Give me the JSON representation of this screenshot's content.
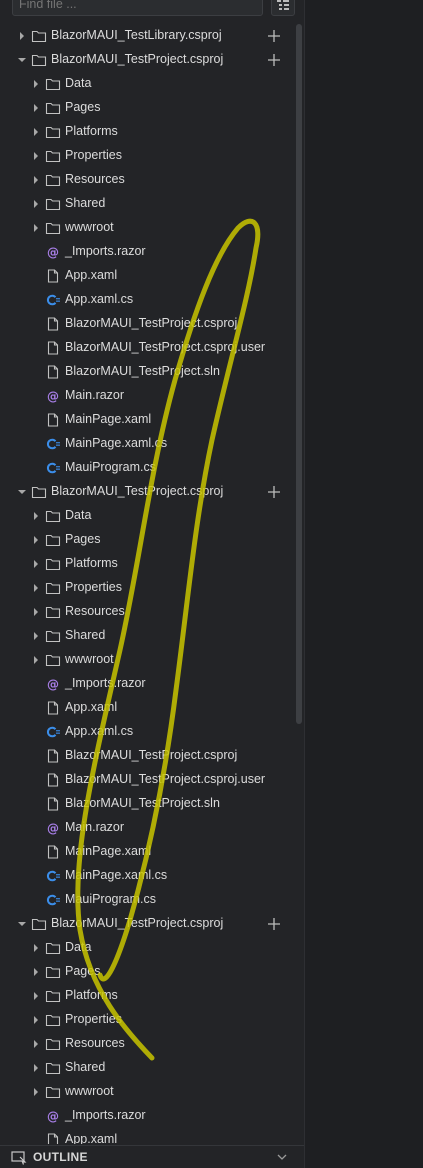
{
  "search": {
    "placeholder": "Find file ..."
  },
  "tree": [
    {
      "depth": 0,
      "kind": "project",
      "expanded": false,
      "label": "BlazorMAUI_TestLibrary.csproj",
      "plus": true
    },
    {
      "depth": 0,
      "kind": "project",
      "expanded": true,
      "label": "BlazorMAUI_TestProject.csproj",
      "plus": true
    },
    {
      "depth": 1,
      "kind": "folder",
      "label": "Data"
    },
    {
      "depth": 1,
      "kind": "folder",
      "label": "Pages"
    },
    {
      "depth": 1,
      "kind": "folder",
      "label": "Platforms"
    },
    {
      "depth": 1,
      "kind": "folder",
      "label": "Properties"
    },
    {
      "depth": 1,
      "kind": "folder",
      "label": "Resources"
    },
    {
      "depth": 1,
      "kind": "folder",
      "label": "Shared"
    },
    {
      "depth": 1,
      "kind": "folder",
      "label": "wwwroot"
    },
    {
      "depth": 1,
      "kind": "razor",
      "label": "_Imports.razor"
    },
    {
      "depth": 1,
      "kind": "file",
      "label": "App.xaml"
    },
    {
      "depth": 1,
      "kind": "cs",
      "label": "App.xaml.cs"
    },
    {
      "depth": 1,
      "kind": "file",
      "label": "BlazorMAUI_TestProject.csproj"
    },
    {
      "depth": 1,
      "kind": "file",
      "label": "BlazorMAUI_TestProject.csproj.user"
    },
    {
      "depth": 1,
      "kind": "file",
      "label": "BlazorMAUI_TestProject.sln"
    },
    {
      "depth": 1,
      "kind": "razor",
      "label": "Main.razor"
    },
    {
      "depth": 1,
      "kind": "file",
      "label": "MainPage.xaml"
    },
    {
      "depth": 1,
      "kind": "cs",
      "label": "MainPage.xaml.cs"
    },
    {
      "depth": 1,
      "kind": "cs",
      "label": "MauiProgram.cs"
    },
    {
      "depth": 0,
      "kind": "project",
      "expanded": true,
      "label": "BlazorMAUI_TestProject.csproj",
      "plus": true
    },
    {
      "depth": 1,
      "kind": "folder",
      "label": "Data"
    },
    {
      "depth": 1,
      "kind": "folder",
      "label": "Pages"
    },
    {
      "depth": 1,
      "kind": "folder",
      "label": "Platforms"
    },
    {
      "depth": 1,
      "kind": "folder",
      "label": "Properties"
    },
    {
      "depth": 1,
      "kind": "folder",
      "label": "Resources"
    },
    {
      "depth": 1,
      "kind": "folder",
      "label": "Shared"
    },
    {
      "depth": 1,
      "kind": "folder",
      "label": "wwwroot"
    },
    {
      "depth": 1,
      "kind": "razor",
      "label": "_Imports.razor"
    },
    {
      "depth": 1,
      "kind": "file",
      "label": "App.xaml"
    },
    {
      "depth": 1,
      "kind": "cs",
      "label": "App.xaml.cs"
    },
    {
      "depth": 1,
      "kind": "file",
      "label": "BlazorMAUI_TestProject.csproj"
    },
    {
      "depth": 1,
      "kind": "file",
      "label": "BlazorMAUI_TestProject.csproj.user"
    },
    {
      "depth": 1,
      "kind": "file",
      "label": "BlazorMAUI_TestProject.sln"
    },
    {
      "depth": 1,
      "kind": "razor",
      "label": "Main.razor"
    },
    {
      "depth": 1,
      "kind": "file",
      "label": "MainPage.xaml"
    },
    {
      "depth": 1,
      "kind": "cs",
      "label": "MainPage.xaml.cs"
    },
    {
      "depth": 1,
      "kind": "cs",
      "label": "MauiProgram.cs"
    },
    {
      "depth": 0,
      "kind": "project",
      "expanded": true,
      "label": "BlazorMAUI_TestProject.csproj",
      "plus": true
    },
    {
      "depth": 1,
      "kind": "folder",
      "label": "Data"
    },
    {
      "depth": 1,
      "kind": "folder",
      "label": "Pages"
    },
    {
      "depth": 1,
      "kind": "folder",
      "label": "Platforms"
    },
    {
      "depth": 1,
      "kind": "folder",
      "label": "Properties"
    },
    {
      "depth": 1,
      "kind": "folder",
      "label": "Resources"
    },
    {
      "depth": 1,
      "kind": "folder",
      "label": "Shared"
    },
    {
      "depth": 1,
      "kind": "folder",
      "label": "wwwroot"
    },
    {
      "depth": 1,
      "kind": "razor",
      "label": "_Imports.razor"
    },
    {
      "depth": 1,
      "kind": "file",
      "label": "App.xaml"
    }
  ],
  "outline": {
    "title": "OUTLINE"
  },
  "colors": {
    "cs_icon": "#3b8eea",
    "razor_icon": "#a77ee6",
    "annotation": "#c8c400",
    "panel_bg": "#232427"
  }
}
